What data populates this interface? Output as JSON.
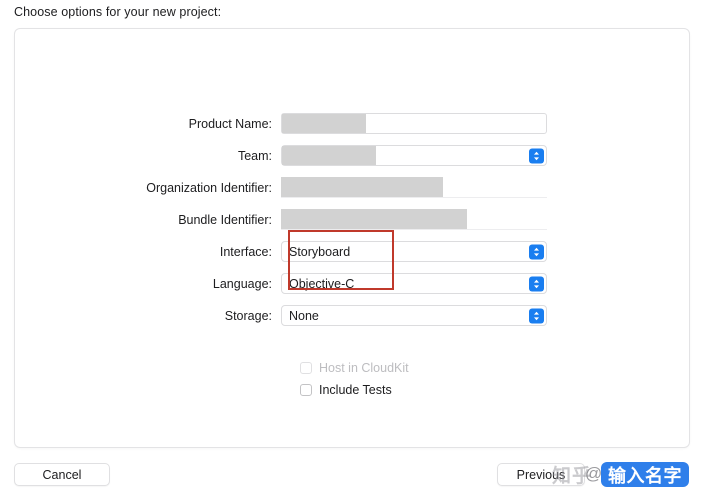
{
  "prompt": "Choose options for your new project:",
  "form": {
    "rows": [
      {
        "label": "Product Name:",
        "type": "textfield",
        "value": "",
        "redacted": true,
        "redact_width": 84
      },
      {
        "label": "Team:",
        "type": "popup",
        "value": "",
        "redacted": true,
        "redact_width": 94
      },
      {
        "label": "Organization Identifier:",
        "type": "plainfield",
        "value": "",
        "redacted": true,
        "redact_width": 162
      },
      {
        "label": "Bundle Identifier:",
        "type": "plainfield",
        "value": "",
        "redacted": true,
        "redact_width": 186
      },
      {
        "label": "Interface:",
        "type": "popup",
        "value": "Storyboard",
        "redacted": false,
        "redact_width": 0
      },
      {
        "label": "Language:",
        "type": "popup",
        "value": "Objective-C",
        "redacted": false,
        "redact_width": 0
      },
      {
        "label": "Storage:",
        "type": "popup",
        "value": "None",
        "redacted": false,
        "redact_width": 0
      }
    ]
  },
  "checkboxes": [
    {
      "label": "Host in CloudKit",
      "checked": false,
      "disabled": true
    },
    {
      "label": "Include Tests",
      "checked": false,
      "disabled": false
    }
  ],
  "footer": {
    "cancel_label": "Cancel",
    "previous_label": "Previous"
  },
  "watermark": {
    "site": "知乎",
    "at": "@",
    "badge_text": "输入名字"
  },
  "colors": {
    "accent_blue": "#1a7ef0",
    "badge_blue": "#2f7fea",
    "annotation_red": "#c0392b",
    "redaction_gray": "#d2d2d2",
    "text": "#1d1d1f",
    "disabled_text": "#bdbdc0",
    "border": "#dcdcde"
  }
}
